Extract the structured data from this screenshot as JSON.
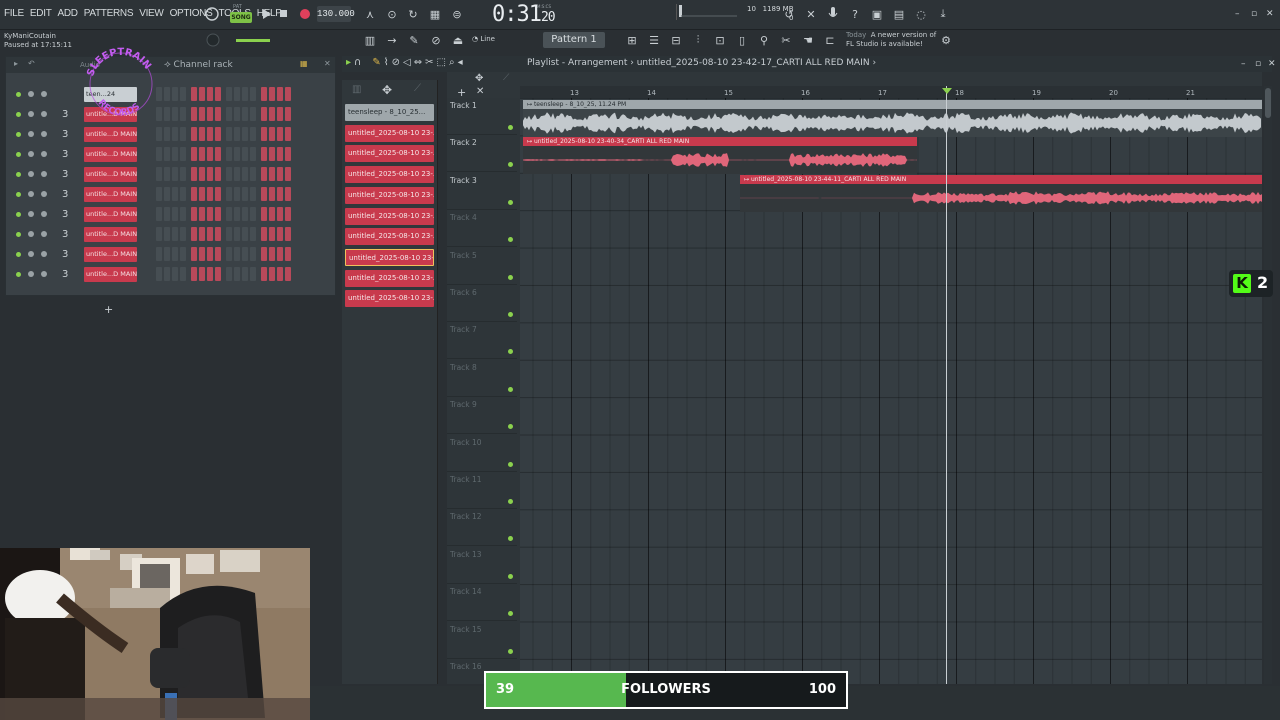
{
  "menu": [
    "FILE",
    "EDIT",
    "ADD",
    "PATTERNS",
    "VIEW",
    "OPTIONS",
    "TOOLS",
    "HELP"
  ],
  "project": {
    "name": "KyManiCoutain",
    "status": "Paused at 17:15:11"
  },
  "transport": {
    "pat_label": "PAT",
    "song_label": "SONG",
    "tempo": "130.000",
    "time_main": "0:31",
    "time_sub": "20",
    "time_unit": "M:S:CS"
  },
  "monitor": {
    "cpu": "10",
    "memory": "1189 MB",
    "polyphony": "0"
  },
  "news": {
    "when": "Today",
    "line1": "A newer version of",
    "line2": "FL Studio is available!"
  },
  "toolbar2": {
    "snap": "Line",
    "pattern": "Pattern 1"
  },
  "channel_rack": {
    "title": "Channel rack",
    "group": "Audio",
    "channels": [
      {
        "num": "",
        "name": "teen...24"
      },
      {
        "num": "3",
        "name": "untitle...D MAIN"
      },
      {
        "num": "3",
        "name": "untitle...D MAIN"
      },
      {
        "num": "3",
        "name": "untitle...D MAIN"
      },
      {
        "num": "3",
        "name": "untitle...D MAIN"
      },
      {
        "num": "3",
        "name": "untitle...D MAIN"
      },
      {
        "num": "3",
        "name": "untitle...D MAIN"
      },
      {
        "num": "3",
        "name": "untitle...D MAIN"
      },
      {
        "num": "3",
        "name": "untitle...D MAIN"
      },
      {
        "num": "3",
        "name": "untitle...D MAIN"
      }
    ],
    "add_label": "+"
  },
  "logo": {
    "text": "SLEEPTRAIN RECORDS"
  },
  "clip_list": [
    "teensleep - 8_10_25...",
    "untitled_2025-08-10 23-...",
    "untitled_2025-08-10 23-...",
    "untitled_2025-08-10 23-...",
    "untitled_2025-08-10 23-...",
    "untitled_2025-08-10 23-...",
    "untitled_2025-08-10 23-...",
    "untitled_2025-08-10 23-...",
    "untitled_2025-08-10 23-...",
    "untitled_2025-08-10 23-..."
  ],
  "playlist": {
    "title": "Playlist - Arrangement",
    "breadcrumb": "untitled_2025-08-10 23-42-17_CARTI ALL RED MAIN",
    "ruler": [
      "13",
      "14",
      "15",
      "16",
      "17",
      "18",
      "19",
      "20",
      "21"
    ],
    "tracks": [
      "Track 1",
      "Track 2",
      "Track 3",
      "Track 4",
      "Track 5",
      "Track 6",
      "Track 7",
      "Track 8",
      "Track 9",
      "Track 10",
      "Track 11",
      "Track 12",
      "Track 13",
      "Track 14",
      "Track 15",
      "Track 16"
    ],
    "clips": [
      {
        "label": "teensleep - 8_10_25, 11.24 PM"
      },
      {
        "label": "untitled_2025-08-10 23-40-34_CARTI ALL RED MAIN"
      },
      {
        "label": "untitled_2025-08-10 23-44-11_CARTI ALL RED MAIN"
      }
    ]
  },
  "kick_badge": {
    "letter": "K",
    "count": "2"
  },
  "followers": {
    "current": "39",
    "label": "FOLLOWERS",
    "goal": "100",
    "progress": 0.39
  },
  "colors": {
    "accent_green": "#8bd14e",
    "clip_red": "#c83a4d",
    "clip_grey": "#9fa7ab",
    "kick_green": "#53fc18",
    "goal_green": "#57b84f"
  }
}
